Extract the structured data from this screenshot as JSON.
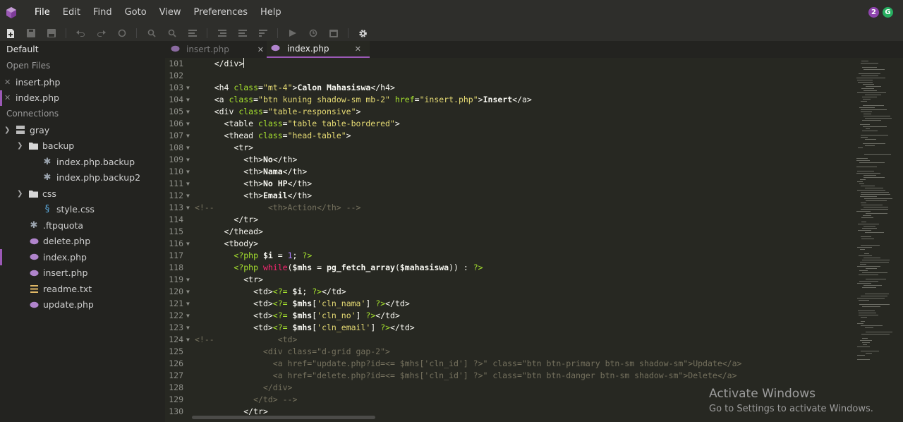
{
  "menubar": {
    "items": [
      "File",
      "Edit",
      "Find",
      "Goto",
      "View",
      "Preferences",
      "Help"
    ],
    "avatars": [
      {
        "label": "2",
        "color": "#8e44ad"
      },
      {
        "label": "G",
        "color": "#27ae60"
      }
    ]
  },
  "toolbar": {
    "icons": [
      "new-file-icon",
      "save-icon",
      "save-all-icon",
      "undo-icon",
      "redo-icon",
      "reload-icon",
      "search-icon",
      "search-replace-icon",
      "format-icon",
      "indent-icon",
      "outdent-icon",
      "sort-icon",
      "run-icon",
      "history-icon",
      "preview-icon",
      "settings-icon"
    ]
  },
  "sidebar": {
    "header": "Default",
    "open_files_label": "Open Files",
    "open_files": [
      "insert.php",
      "index.php"
    ],
    "connections_label": "Connections",
    "tree": {
      "root": "gray",
      "backup": {
        "label": "backup",
        "files": [
          "index.php.backup",
          "index.php.backup2"
        ]
      },
      "css": {
        "label": "css",
        "files": [
          "style.css"
        ]
      },
      "files": [
        ".ftpquota",
        "delete.php",
        "index.php",
        "insert.php",
        "readme.txt",
        "update.php"
      ]
    }
  },
  "tabs": [
    {
      "label": "insert.php",
      "active": false
    },
    {
      "label": "index.php",
      "active": true
    }
  ],
  "editor": {
    "line_numbers": [
      "101",
      "102",
      "103",
      "104",
      "105",
      "106",
      "107",
      "108",
      "109",
      "110",
      "111",
      "112",
      "113",
      "114",
      "115",
      "116",
      "117",
      "118",
      "119",
      "120",
      "121",
      "122",
      "123",
      "124",
      "125",
      "126",
      "127",
      "128",
      "129",
      "130"
    ]
  },
  "watermark": {
    "title": "Activate Windows",
    "subtitle": "Go to Settings to activate Windows."
  },
  "colors": {
    "accent": "#9b59b6",
    "background": "#272822",
    "sidebar": "#232320"
  }
}
